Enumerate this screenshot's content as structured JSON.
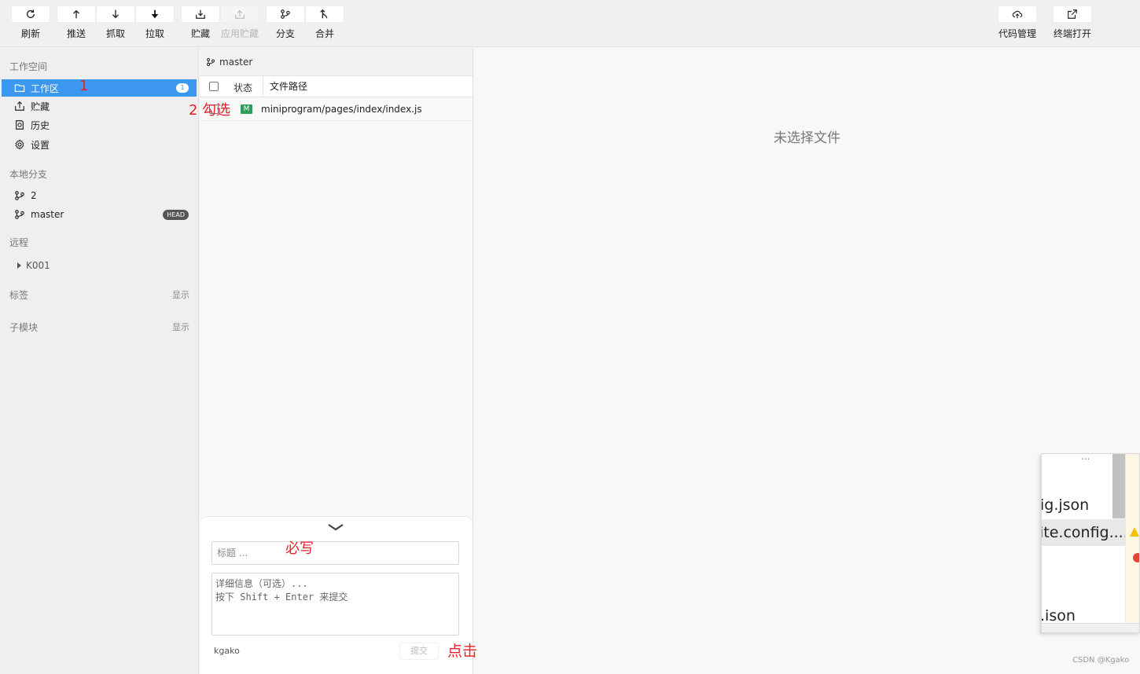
{
  "toolbar": {
    "refresh": "刷新",
    "push": "推送",
    "fetch": "抓取",
    "pull": "拉取",
    "stash": "贮藏",
    "apply_stash": "应用贮藏",
    "branch": "分支",
    "merge": "合并",
    "code_manage": "代码管理",
    "terminal_open": "终端打开"
  },
  "sidebar": {
    "workspace_title": "工作空间",
    "workspace_items": [
      {
        "label": "工作区",
        "badge": "1",
        "icon": "folder-icon"
      },
      {
        "label": "贮藏",
        "icon": "stash-icon"
      },
      {
        "label": "历史",
        "icon": "history-icon"
      },
      {
        "label": "设置",
        "icon": "gear-icon"
      }
    ],
    "local_branches_title": "本地分支",
    "local_branches": [
      {
        "label": "2",
        "icon": "branch-icon"
      },
      {
        "label": "master",
        "badge": "HEAD",
        "icon": "branch-icon"
      }
    ],
    "remote_title": "远程",
    "remotes": [
      {
        "label": "K001"
      }
    ],
    "tags_title": "标签",
    "tags_action": "显示",
    "submodules_title": "子模块",
    "submodules_action": "显示"
  },
  "changes": {
    "current_branch": "master",
    "col_status": "状态",
    "col_path": "文件路径",
    "files": [
      {
        "status": "M",
        "path": "miniprogram/pages/index/index.js",
        "checked": false
      }
    ]
  },
  "commit": {
    "title_placeholder": "标题 ...",
    "desc_placeholder": "详细信息（可选）...\n按下 Shift + Enter 来提交",
    "author": "kgako",
    "submit": "提交"
  },
  "preview": {
    "empty_message": "未选择文件"
  },
  "annotations": {
    "step1": "1",
    "step2": "2 勾选",
    "required": "必写",
    "click": "点击",
    "color": "#e8212a"
  },
  "overlay": {
    "line1": "ig.json",
    "line2": "ite.config....",
    "line3": ".ison",
    "dots": "..."
  },
  "watermark": "CSDN @Kgako",
  "colors": {
    "accent": "#3b97f0",
    "modified_badge": "#2f9e5a"
  }
}
